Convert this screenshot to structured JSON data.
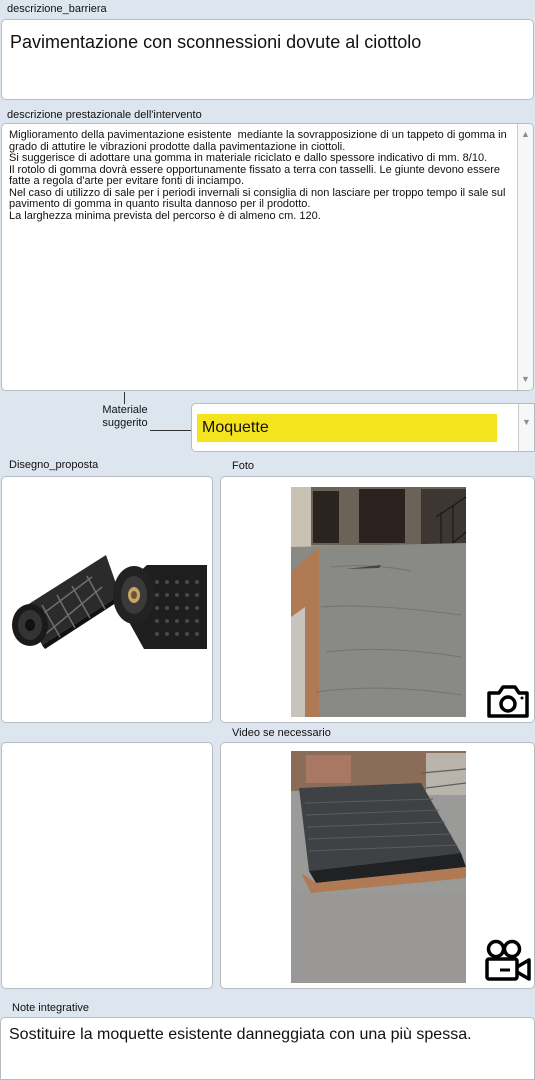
{
  "barrier": {
    "label": "descrizione_barriera",
    "value": "Pavimentazione con sconnessioni dovute al ciottolo"
  },
  "description": {
    "label": "descrizione prestazionale dell'intervento",
    "value": "Miglioramento della pavimentazione esistente  mediante la sovrapposizione di un tappeto di gomma in grado di attutire le vibrazioni prodotte dalla pavimentazione in ciottoli.\nSi suggerisce di adottare una gomma in materiale riciclato e dallo spessore indicativo di mm. 8/10.\nIl rotolo di gomma dovrà essere opportunamente fissato a terra con tasselli. Le giunte devono essere fatte a regola d'arte per evitare fonti di inciampo.\nNel caso di utilizzo di sale per i periodi invernali si consiglia di non lasciare per troppo tempo il sale sul pavimento di gomma in quanto risulta dannoso per il prodotto.\nLa larghezza minima prevista del percorso è di almeno cm. 120."
  },
  "material": {
    "label_line1": "Materiale",
    "label_line2": "suggerito",
    "value": "Moquette",
    "highlight_color": "#f4e41e"
  },
  "drawing": {
    "label": "Disegno_proposta"
  },
  "photo": {
    "label": "Foto",
    "icon": "camera-icon"
  },
  "video": {
    "label": "Video se necessario",
    "icon": "video-camera-icon"
  },
  "notes": {
    "label": "Note integrative",
    "value": "Sostituire la moquette esistente danneggiata con una più spessa."
  }
}
